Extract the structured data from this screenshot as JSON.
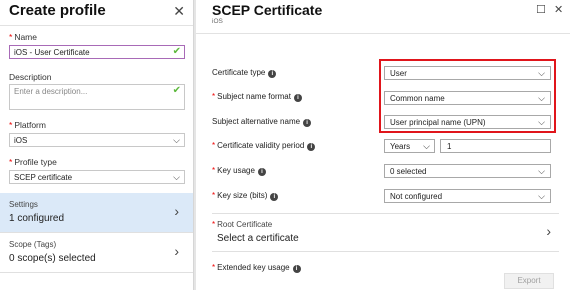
{
  "left": {
    "title": "Create profile",
    "name": {
      "label": "Name",
      "value": "iOS - User Certificate"
    },
    "description": {
      "label": "Description",
      "placeholder": "Enter a description..."
    },
    "platform": {
      "label": "Platform",
      "value": "iOS"
    },
    "profile_type": {
      "label": "Profile type",
      "value": "SCEP certificate"
    },
    "settings": {
      "label": "Settings",
      "value": "1 configured"
    },
    "scope": {
      "label": "Scope (Tags)",
      "value": "0 scope(s) selected"
    }
  },
  "right": {
    "title": "SCEP Certificate",
    "subtitle": "iOS",
    "certificate_type": {
      "label": "Certificate type",
      "value": "User"
    },
    "subject_name_format": {
      "label": "Subject name format",
      "value": "Common name"
    },
    "subject_alt_name": {
      "label": "Subject alternative name",
      "value": "User principal name (UPN)"
    },
    "validity": {
      "label": "Certificate validity period",
      "unit": "Years",
      "value": "1"
    },
    "key_usage": {
      "label": "Key usage",
      "value": "0 selected"
    },
    "key_size": {
      "label": "Key size (bits)",
      "value": "Not configured"
    },
    "root_cert": {
      "label": "Root Certificate",
      "value": "Select a certificate"
    },
    "eku": {
      "label": "Extended key usage"
    },
    "export_label": "Export"
  },
  "icons": {
    "close": "close-icon",
    "chevron": "chevron-down-icon",
    "check": "check-icon",
    "info": "info-icon"
  },
  "colors": {
    "highlight": "#e0151b",
    "selected_nav": "#dbe9f8",
    "valid_check": "#5cb83c",
    "required": "#e00000"
  }
}
